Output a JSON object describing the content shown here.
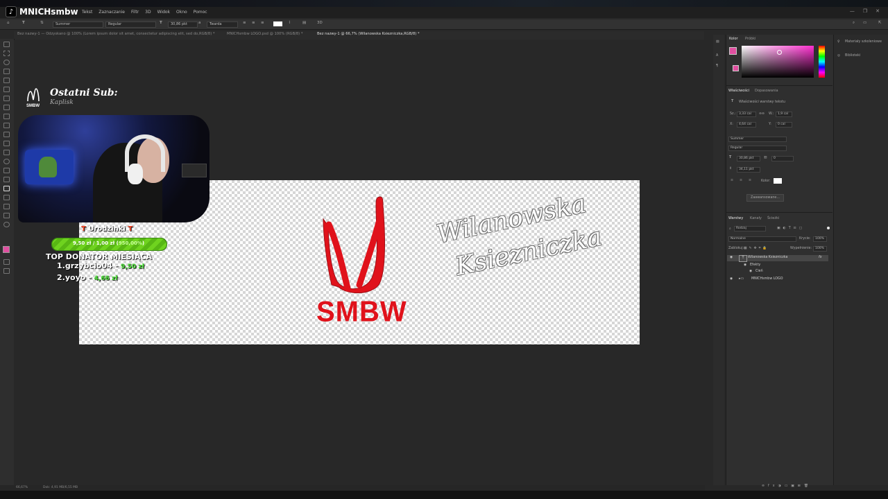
{
  "brand": {
    "name": "MNICHsmbw"
  },
  "menu": [
    "Tekst",
    "Zaznaczanie",
    "Filtr",
    "3D",
    "Widok",
    "Okno",
    "Pomoc"
  ],
  "options": {
    "font": "Summer",
    "style": "Regular",
    "size": "30,86 pkt",
    "aa": "Twarda"
  },
  "tabs": [
    "Bez nazwy-1 — Odzyskano @ 100% (Lorem ipsum dolor sit amet, consectetur adipiscing elit, sed do,RGB/8) *",
    "MNICHsmbw LOGO.psd @ 100% (RGB/8) *",
    "Bez nazwy-1 @ 66,7% (Wilanowska Ksiezniczka,RGB/8) *"
  ],
  "canvas": {
    "logo_text": "SMBW",
    "script_line1": "Wilanowska",
    "script_line2": "Ksiezniczka",
    "accent": "#e0121b"
  },
  "overlay": {
    "last_sub_title": "Ostatni Sub:",
    "last_sub_name": "Kaplisk",
    "birthday_label": "Urodzinki",
    "goal_current": "9,50 zł",
    "goal_target": "1,00 zł",
    "goal_percent": "950,00%",
    "goal_progress": 1.0,
    "top_donators_title": "TOP DONATOR MIESIĄCA",
    "donators": [
      {
        "rank": "1.",
        "name": "grzybcio04 -",
        "amount": "9,50 zł"
      },
      {
        "rank": "2.",
        "name": "yoyo -",
        "amount": "4,66 zł"
      }
    ]
  },
  "panels": {
    "color_tabs": [
      "Kolor",
      "Próbki"
    ],
    "props_tabs": [
      "Właściwości",
      "Dopasowania"
    ],
    "props_title": "Właściwości warstwy tekstu",
    "W": "3,33 cal",
    "H": "1,9 cal",
    "X": "4,64 cal",
    "Y": "0 cal",
    "font": "Summer",
    "style": "Regular",
    "size": "30,86 pkt",
    "tracking": "0",
    "leading": "34,11 pkt",
    "color_label": "Kolor:",
    "advanced": "Zaawansowane...",
    "layers_tabs": [
      "Warstwy",
      "Kanały",
      "Ścieżki"
    ],
    "layer_filter": "Rodzaj",
    "blend": "Normalne",
    "opacity_label": "Krycie:",
    "opacity": "100%",
    "lock_label": "Zablokuj:",
    "fill_label": "Wypełnienie:",
    "fill": "100%",
    "layers": [
      "Wilanowska Ksiezniczka",
      "Efekty",
      "Cień",
      "MNICHsmbw LOGO"
    ],
    "far_right": [
      "Materiały szkoleniowe",
      "Biblioteki"
    ]
  },
  "status": {
    "zoom": "66,67%",
    "doc": "Dok: 4,91 MB/6,55 MB"
  }
}
